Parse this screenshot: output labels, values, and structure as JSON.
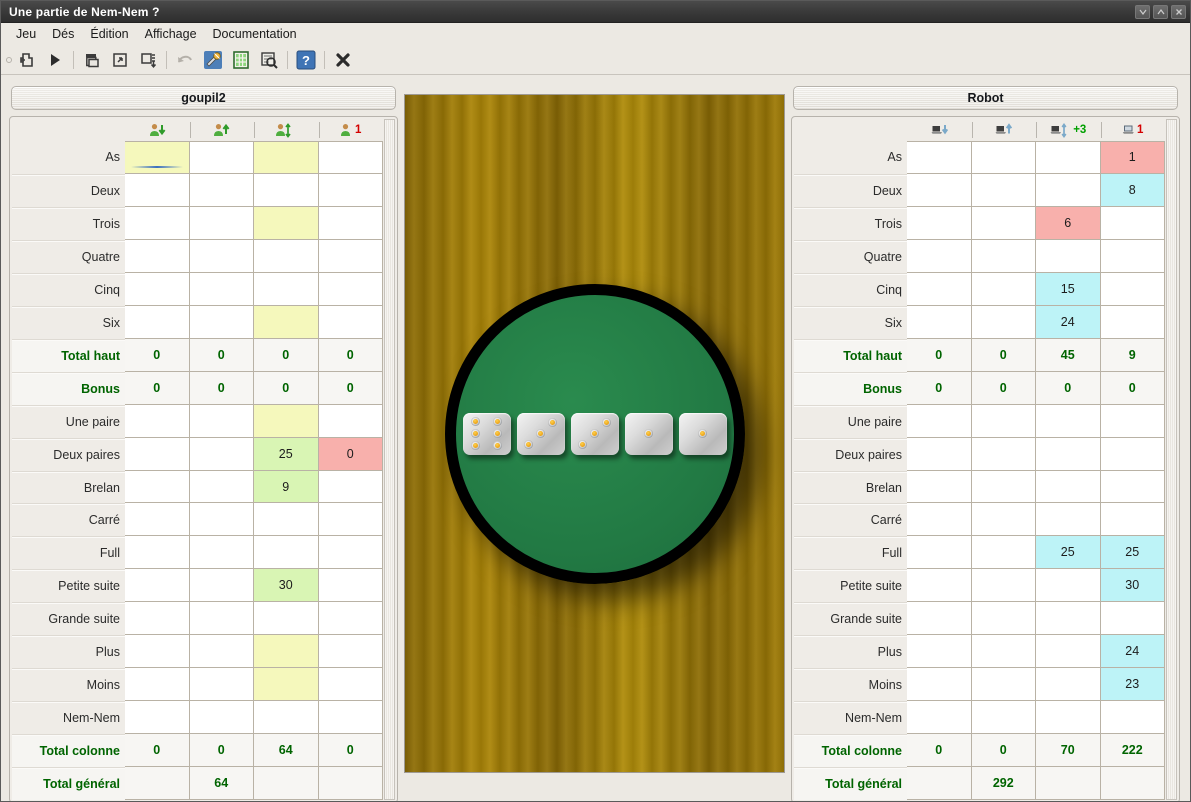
{
  "window": {
    "title": "Une partie de Nem-Nem ?",
    "buttons": [
      {
        "name": "minimize",
        "glyph": "⌵"
      },
      {
        "name": "maximize",
        "glyph": "⌃"
      },
      {
        "name": "close",
        "glyph": "✕"
      }
    ]
  },
  "menubar": {
    "items": [
      "Jeu",
      "Dés",
      "Édition",
      "Affichage",
      "Documentation"
    ]
  },
  "toolbar": {
    "buttons": [
      {
        "name": "new-game-icon",
        "title": "Nouvelle partie"
      },
      {
        "name": "play-icon",
        "title": "Jouer"
      },
      {
        "name": "copy-icon",
        "title": "Copier"
      },
      {
        "name": "paste-icon",
        "title": "Coller"
      },
      {
        "name": "save-as-icon",
        "title": "Enregistrer sous"
      },
      {
        "name": "undo-icon",
        "title": "Annuler"
      },
      {
        "name": "preferences-icon",
        "title": "Préférences"
      },
      {
        "name": "scores-table-icon",
        "title": "Tableau des scores"
      },
      {
        "name": "print-preview-icon",
        "title": "Aperçu"
      },
      {
        "name": "help-icon",
        "title": "Aide"
      },
      {
        "name": "quit-icon",
        "title": "Quitter"
      }
    ]
  },
  "row_labels": [
    "As",
    "Deux",
    "Trois",
    "Quatre",
    "Cinq",
    "Six",
    "Total haut",
    "Bonus",
    "Une paire",
    "Deux paires",
    "Brelan",
    "Carré",
    "Full",
    "Petite suite",
    "Grande suite",
    "Plus",
    "Moins",
    "Nem-Nem",
    "Total colonne",
    "Total général"
  ],
  "players": [
    {
      "name": "goupil2",
      "icon_kind": "person",
      "columns": [
        {
          "icon": "person-down-icon",
          "badge": ""
        },
        {
          "icon": "person-up-icon",
          "badge": ""
        },
        {
          "icon": "person-updown-icon",
          "badge": ""
        },
        {
          "icon": "person-free-icon",
          "badge": "1",
          "badge_color": "#d40000"
        }
      ],
      "rows": [
        {
          "label": "As",
          "type": "score",
          "cells": [
            {
              "v": "",
              "s": "yellow",
              "focus": true
            },
            {
              "v": "",
              "s": ""
            },
            {
              "v": "",
              "s": "yellow"
            },
            {
              "v": "",
              "s": ""
            }
          ]
        },
        {
          "label": "Deux",
          "type": "score",
          "cells": [
            {
              "v": "",
              "s": ""
            },
            {
              "v": "",
              "s": ""
            },
            {
              "v": "",
              "s": ""
            },
            {
              "v": "",
              "s": ""
            }
          ]
        },
        {
          "label": "Trois",
          "type": "score",
          "cells": [
            {
              "v": "",
              "s": ""
            },
            {
              "v": "",
              "s": ""
            },
            {
              "v": "",
              "s": "yellow"
            },
            {
              "v": "",
              "s": ""
            }
          ]
        },
        {
          "label": "Quatre",
          "type": "score",
          "cells": [
            {
              "v": "",
              "s": ""
            },
            {
              "v": "",
              "s": ""
            },
            {
              "v": "",
              "s": ""
            },
            {
              "v": "",
              "s": ""
            }
          ]
        },
        {
          "label": "Cinq",
          "type": "score",
          "cells": [
            {
              "v": "",
              "s": ""
            },
            {
              "v": "",
              "s": ""
            },
            {
              "v": "",
              "s": ""
            },
            {
              "v": "",
              "s": ""
            }
          ]
        },
        {
          "label": "Six",
          "type": "score",
          "cells": [
            {
              "v": "",
              "s": ""
            },
            {
              "v": "",
              "s": ""
            },
            {
              "v": "",
              "s": "yellow"
            },
            {
              "v": "",
              "s": ""
            }
          ]
        },
        {
          "label": "Total haut",
          "type": "total",
          "cells": [
            {
              "v": "0",
              "s": ""
            },
            {
              "v": "0",
              "s": ""
            },
            {
              "v": "0",
              "s": ""
            },
            {
              "v": "0",
              "s": ""
            }
          ]
        },
        {
          "label": "Bonus",
          "type": "total",
          "cells": [
            {
              "v": "0",
              "s": ""
            },
            {
              "v": "0",
              "s": ""
            },
            {
              "v": "0",
              "s": ""
            },
            {
              "v": "0",
              "s": ""
            }
          ]
        },
        {
          "label": "Une paire",
          "type": "score",
          "cells": [
            {
              "v": "",
              "s": ""
            },
            {
              "v": "",
              "s": ""
            },
            {
              "v": "",
              "s": "yellow"
            },
            {
              "v": "",
              "s": ""
            }
          ]
        },
        {
          "label": "Deux paires",
          "type": "score",
          "cells": [
            {
              "v": "",
              "s": ""
            },
            {
              "v": "",
              "s": ""
            },
            {
              "v": "25",
              "s": "green"
            },
            {
              "v": "0",
              "s": "red"
            }
          ]
        },
        {
          "label": "Brelan",
          "type": "score",
          "cells": [
            {
              "v": "",
              "s": ""
            },
            {
              "v": "",
              "s": ""
            },
            {
              "v": "9",
              "s": "green"
            },
            {
              "v": "",
              "s": ""
            }
          ]
        },
        {
          "label": "Carré",
          "type": "score",
          "cells": [
            {
              "v": "",
              "s": ""
            },
            {
              "v": "",
              "s": ""
            },
            {
              "v": "",
              "s": ""
            },
            {
              "v": "",
              "s": ""
            }
          ]
        },
        {
          "label": "Full",
          "type": "score",
          "cells": [
            {
              "v": "",
              "s": ""
            },
            {
              "v": "",
              "s": ""
            },
            {
              "v": "",
              "s": ""
            },
            {
              "v": "",
              "s": ""
            }
          ]
        },
        {
          "label": "Petite suite",
          "type": "score",
          "cells": [
            {
              "v": "",
              "s": ""
            },
            {
              "v": "",
              "s": ""
            },
            {
              "v": "30",
              "s": "green"
            },
            {
              "v": "",
              "s": ""
            }
          ]
        },
        {
          "label": "Grande suite",
          "type": "score",
          "cells": [
            {
              "v": "",
              "s": ""
            },
            {
              "v": "",
              "s": ""
            },
            {
              "v": "",
              "s": ""
            },
            {
              "v": "",
              "s": ""
            }
          ]
        },
        {
          "label": "Plus",
          "type": "score",
          "cells": [
            {
              "v": "",
              "s": ""
            },
            {
              "v": "",
              "s": ""
            },
            {
              "v": "",
              "s": "yellow"
            },
            {
              "v": "",
              "s": ""
            }
          ]
        },
        {
          "label": "Moins",
          "type": "score",
          "cells": [
            {
              "v": "",
              "s": ""
            },
            {
              "v": "",
              "s": ""
            },
            {
              "v": "",
              "s": "yellow"
            },
            {
              "v": "",
              "s": ""
            }
          ]
        },
        {
          "label": "Nem-Nem",
          "type": "score",
          "cells": [
            {
              "v": "",
              "s": ""
            },
            {
              "v": "",
              "s": ""
            },
            {
              "v": "",
              "s": ""
            },
            {
              "v": "",
              "s": ""
            }
          ]
        },
        {
          "label": "Total colonne",
          "type": "total",
          "cells": [
            {
              "v": "0",
              "s": ""
            },
            {
              "v": "0",
              "s": ""
            },
            {
              "v": "64",
              "s": ""
            },
            {
              "v": "0",
              "s": ""
            }
          ]
        },
        {
          "label": "Total général",
          "type": "total",
          "cells": [
            {
              "v": "",
              "s": ""
            },
            {
              "v": "64",
              "s": ""
            },
            {
              "v": "",
              "s": ""
            },
            {
              "v": "",
              "s": ""
            }
          ]
        }
      ]
    },
    {
      "name": "Robot",
      "icon_kind": "computer",
      "columns": [
        {
          "icon": "computer-down-icon",
          "badge": ""
        },
        {
          "icon": "computer-up-icon",
          "badge": ""
        },
        {
          "icon": "computer-updown-icon",
          "badge": "+3",
          "badge_color": "#00a000"
        },
        {
          "icon": "computer-free-icon",
          "badge": "1",
          "badge_color": "#d40000"
        }
      ],
      "rows": [
        {
          "label": "As",
          "type": "score",
          "cells": [
            {
              "v": "",
              "s": ""
            },
            {
              "v": "",
              "s": ""
            },
            {
              "v": "",
              "s": ""
            },
            {
              "v": "1",
              "s": "red"
            }
          ]
        },
        {
          "label": "Deux",
          "type": "score",
          "cells": [
            {
              "v": "",
              "s": ""
            },
            {
              "v": "",
              "s": ""
            },
            {
              "v": "",
              "s": ""
            },
            {
              "v": "8",
              "s": "cyan"
            }
          ]
        },
        {
          "label": "Trois",
          "type": "score",
          "cells": [
            {
              "v": "",
              "s": ""
            },
            {
              "v": "",
              "s": ""
            },
            {
              "v": "6",
              "s": "red"
            },
            {
              "v": "",
              "s": ""
            }
          ]
        },
        {
          "label": "Quatre",
          "type": "score",
          "cells": [
            {
              "v": "",
              "s": ""
            },
            {
              "v": "",
              "s": ""
            },
            {
              "v": "",
              "s": ""
            },
            {
              "v": "",
              "s": ""
            }
          ]
        },
        {
          "label": "Cinq",
          "type": "score",
          "cells": [
            {
              "v": "",
              "s": ""
            },
            {
              "v": "",
              "s": ""
            },
            {
              "v": "15",
              "s": "cyan"
            },
            {
              "v": "",
              "s": ""
            }
          ]
        },
        {
          "label": "Six",
          "type": "score",
          "cells": [
            {
              "v": "",
              "s": ""
            },
            {
              "v": "",
              "s": ""
            },
            {
              "v": "24",
              "s": "cyan"
            },
            {
              "v": "",
              "s": ""
            }
          ]
        },
        {
          "label": "Total haut",
          "type": "total",
          "cells": [
            {
              "v": "0",
              "s": ""
            },
            {
              "v": "0",
              "s": ""
            },
            {
              "v": "45",
              "s": ""
            },
            {
              "v": "9",
              "s": ""
            }
          ]
        },
        {
          "label": "Bonus",
          "type": "total",
          "cells": [
            {
              "v": "0",
              "s": ""
            },
            {
              "v": "0",
              "s": ""
            },
            {
              "v": "0",
              "s": ""
            },
            {
              "v": "0",
              "s": ""
            }
          ]
        },
        {
          "label": "Une paire",
          "type": "score",
          "cells": [
            {
              "v": "",
              "s": ""
            },
            {
              "v": "",
              "s": ""
            },
            {
              "v": "",
              "s": ""
            },
            {
              "v": "",
              "s": ""
            }
          ]
        },
        {
          "label": "Deux paires",
          "type": "score",
          "cells": [
            {
              "v": "",
              "s": ""
            },
            {
              "v": "",
              "s": ""
            },
            {
              "v": "",
              "s": ""
            },
            {
              "v": "",
              "s": ""
            }
          ]
        },
        {
          "label": "Brelan",
          "type": "score",
          "cells": [
            {
              "v": "",
              "s": ""
            },
            {
              "v": "",
              "s": ""
            },
            {
              "v": "",
              "s": ""
            },
            {
              "v": "",
              "s": ""
            }
          ]
        },
        {
          "label": "Carré",
          "type": "score",
          "cells": [
            {
              "v": "",
              "s": ""
            },
            {
              "v": "",
              "s": ""
            },
            {
              "v": "",
              "s": ""
            },
            {
              "v": "",
              "s": ""
            }
          ]
        },
        {
          "label": "Full",
          "type": "score",
          "cells": [
            {
              "v": "",
              "s": ""
            },
            {
              "v": "",
              "s": ""
            },
            {
              "v": "25",
              "s": "cyan"
            },
            {
              "v": "25",
              "s": "cyan"
            }
          ]
        },
        {
          "label": "Petite suite",
          "type": "score",
          "cells": [
            {
              "v": "",
              "s": ""
            },
            {
              "v": "",
              "s": ""
            },
            {
              "v": "",
              "s": ""
            },
            {
              "v": "30",
              "s": "cyan"
            }
          ]
        },
        {
          "label": "Grande suite",
          "type": "score",
          "cells": [
            {
              "v": "",
              "s": ""
            },
            {
              "v": "",
              "s": ""
            },
            {
              "v": "",
              "s": ""
            },
            {
              "v": "",
              "s": ""
            }
          ]
        },
        {
          "label": "Plus",
          "type": "score",
          "cells": [
            {
              "v": "",
              "s": ""
            },
            {
              "v": "",
              "s": ""
            },
            {
              "v": "",
              "s": ""
            },
            {
              "v": "24",
              "s": "cyan"
            }
          ]
        },
        {
          "label": "Moins",
          "type": "score",
          "cells": [
            {
              "v": "",
              "s": ""
            },
            {
              "v": "",
              "s": ""
            },
            {
              "v": "",
              "s": ""
            },
            {
              "v": "23",
              "s": "cyan"
            }
          ]
        },
        {
          "label": "Nem-Nem",
          "type": "score",
          "cells": [
            {
              "v": "",
              "s": ""
            },
            {
              "v": "",
              "s": ""
            },
            {
              "v": "",
              "s": ""
            },
            {
              "v": "",
              "s": ""
            }
          ]
        },
        {
          "label": "Total colonne",
          "type": "total",
          "cells": [
            {
              "v": "0",
              "s": ""
            },
            {
              "v": "0",
              "s": ""
            },
            {
              "v": "70",
              "s": ""
            },
            {
              "v": "222",
              "s": ""
            }
          ]
        },
        {
          "label": "Total général",
          "type": "total",
          "cells": [
            {
              "v": "",
              "s": ""
            },
            {
              "v": "292",
              "s": ""
            },
            {
              "v": "",
              "s": ""
            },
            {
              "v": "",
              "s": ""
            }
          ]
        }
      ]
    }
  ],
  "board": {
    "dice": [
      6,
      3,
      3,
      1,
      1
    ],
    "felt_color": "#22803f",
    "table_color": "#9a7806"
  }
}
